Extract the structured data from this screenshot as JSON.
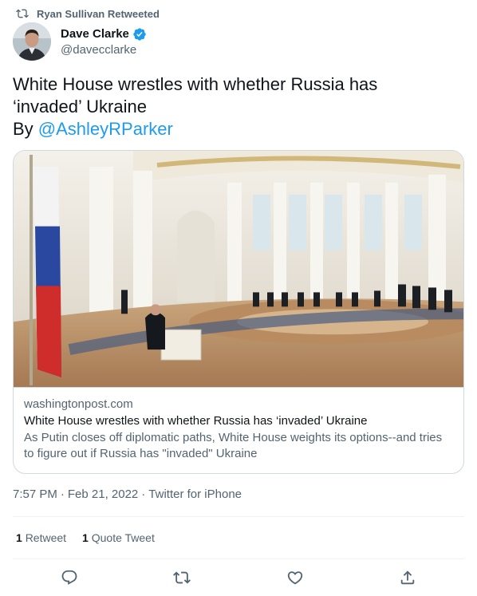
{
  "retweet": {
    "text": "Ryan Sullivan Retweeted",
    "icon": "retweet-icon"
  },
  "author": {
    "name": "Dave Clarke",
    "handle": "@davecclarke",
    "verified": true,
    "avatar": "avatar-photo"
  },
  "tweet": {
    "text_line1": "White House wrestles with whether Russia has",
    "text_line2": "‘invaded’ Ukraine",
    "by": "By ",
    "mention": "@AshleyRParker"
  },
  "card": {
    "domain": "washingtonpost.com",
    "title": "White House wrestles with whether Russia has ‘invaded’ Ukraine",
    "description": "As Putin closes off diplomatic paths, White House weights its options--and tries to figure out if Russia has \"invaded\" Ukraine"
  },
  "meta": {
    "time": "7:57 PM",
    "sep1": "·",
    "date": "Feb 21, 2022",
    "sep2": "·",
    "source": "Twitter for iPhone"
  },
  "stats": {
    "retweets": "1",
    "retweets_label": "Retweet",
    "quotes": "1",
    "quotes_label": "Quote Tweet"
  },
  "actions": [
    "reply-icon",
    "retweet-icon",
    "like-icon",
    "share-icon"
  ],
  "colors": {
    "link": "#1d9bf0",
    "muted": "#536471",
    "text": "#0f1419",
    "border": "#cfd9de"
  }
}
